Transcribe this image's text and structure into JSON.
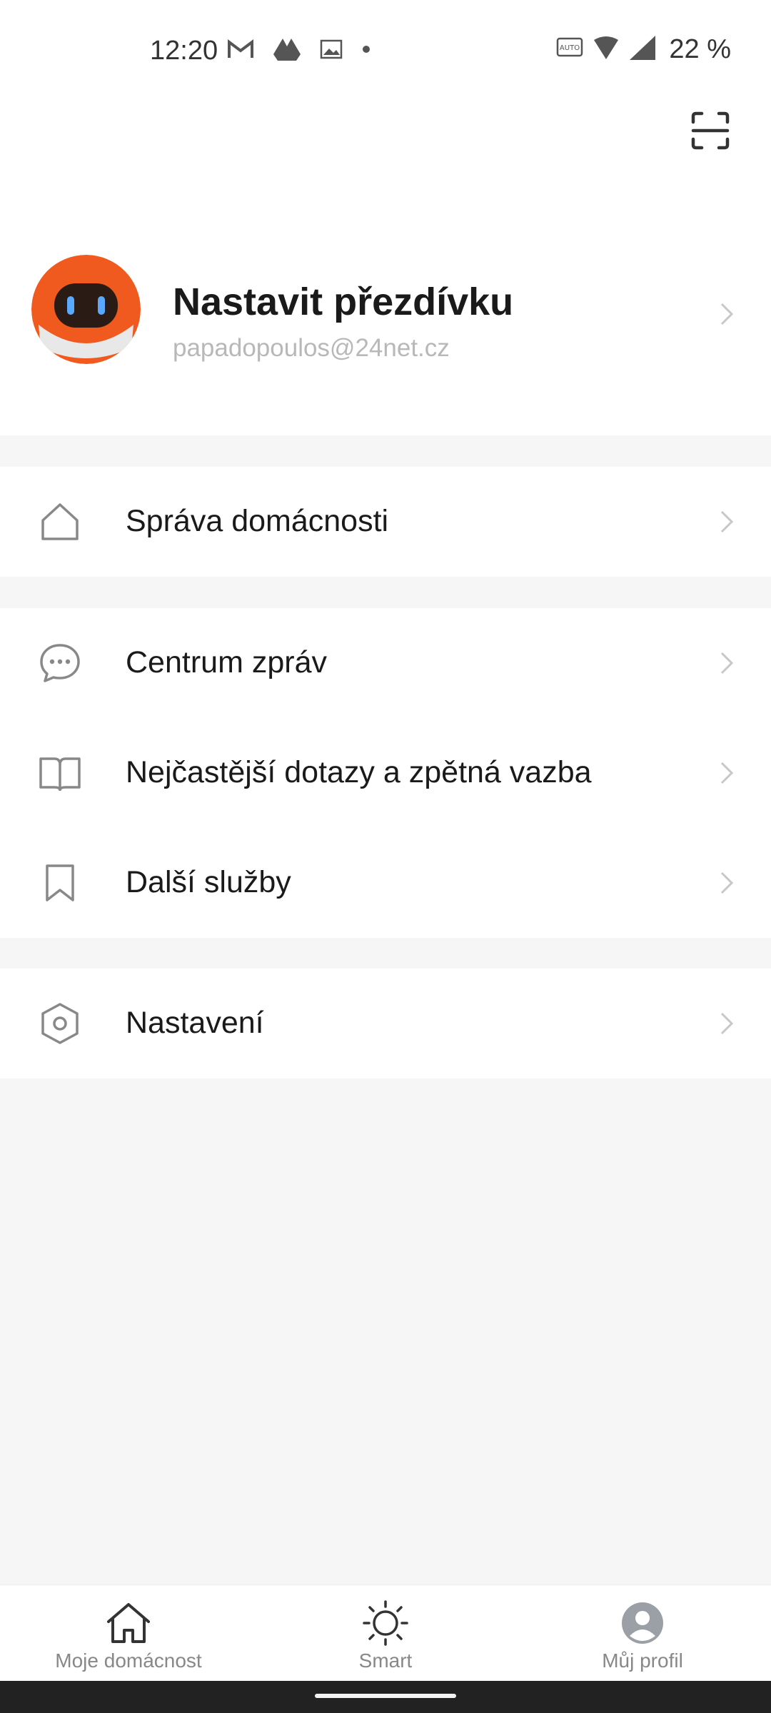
{
  "status_bar": {
    "time": "12:20",
    "battery": "22 %",
    "left_icons": [
      "gmail-icon",
      "drive-icon",
      "gallery-icon",
      "dot-icon"
    ],
    "right_icons": [
      "auto-hz-icon",
      "wifi-icon",
      "signal-icon"
    ]
  },
  "header": {
    "scan_icon": "scan-icon"
  },
  "profile": {
    "name": "Nastavit přezdívku",
    "email": "papadopoulos@24net.cz",
    "avatar": "robot-avatar"
  },
  "menu_groups": [
    {
      "items": [
        {
          "label": "Správa domácnosti",
          "icon": "home-outline-icon"
        }
      ]
    },
    {
      "items": [
        {
          "label": "Centrum zpráv",
          "icon": "chat-bubble-icon"
        },
        {
          "label": "Nejčastější dotazy a zpětná vazba",
          "icon": "book-icon"
        },
        {
          "label": "Další služby",
          "icon": "bookmark-icon"
        }
      ]
    },
    {
      "items": [
        {
          "label": "Nastavení",
          "icon": "settings-hexagon-icon"
        }
      ]
    }
  ],
  "bottom_nav": {
    "items": [
      {
        "label": "Moje domácnost",
        "icon": "home-icon"
      },
      {
        "label": "Smart",
        "icon": "sun-icon"
      },
      {
        "label": "Můj profil",
        "icon": "profile-icon"
      }
    ]
  },
  "colors": {
    "background": "#f6f6f6",
    "card": "#ffffff",
    "avatar_orange": "#f05a1e",
    "text_primary": "#1a1a1a",
    "text_secondary": "#b8b8b8",
    "nav_label": "#888888"
  }
}
